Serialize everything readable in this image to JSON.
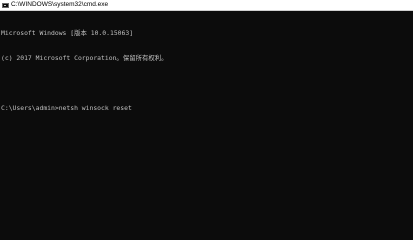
{
  "window": {
    "title": "C:\\WINDOWS\\system32\\cmd.exe",
    "icon": "cmd-icon",
    "colors": {
      "background": "#0c0c0c",
      "text": "#c0c0c0",
      "titlebar": "#ffffff"
    }
  },
  "console": {
    "lines": [
      "Microsoft Windows [版本 10.0.15063]",
      "(c) 2017 Microsoft Corporation。保留所有权利。",
      "",
      "C:\\Users\\admin>netsh winsock reset"
    ]
  }
}
